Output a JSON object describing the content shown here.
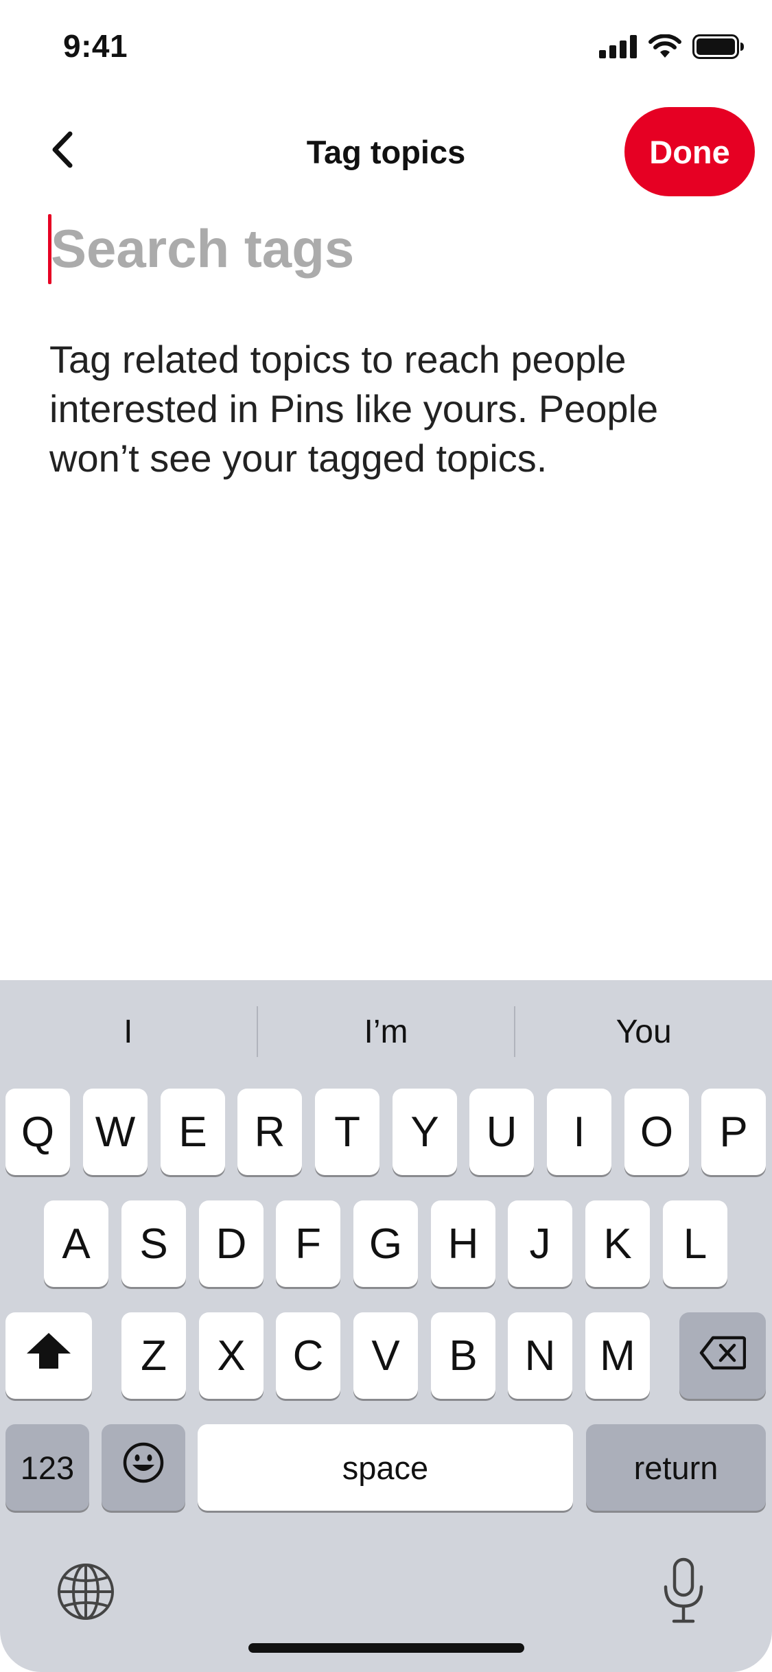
{
  "status_bar": {
    "time": "9:41",
    "icons": [
      "cellular-signal-icon",
      "wifi-icon",
      "battery-icon"
    ]
  },
  "header": {
    "back_icon": "chevron-left-icon",
    "title": "Tag topics",
    "done_label": "Done"
  },
  "search": {
    "placeholder": "Search tags",
    "value": ""
  },
  "description": "Tag related topics to reach people interested in Pins like yours. People won’t see your tagged topics.",
  "keyboard": {
    "suggestions": [
      "I",
      "I’m",
      "You"
    ],
    "row1": [
      "Q",
      "W",
      "E",
      "R",
      "T",
      "Y",
      "U",
      "I",
      "O",
      "P"
    ],
    "row2": [
      "A",
      "S",
      "D",
      "F",
      "G",
      "H",
      "J",
      "K",
      "L"
    ],
    "row3": [
      "Z",
      "X",
      "C",
      "V",
      "B",
      "N",
      "M"
    ],
    "numbers_label": "123",
    "space_label": "space",
    "return_label": "return",
    "icons": [
      "shift-icon",
      "backspace-icon",
      "emoji-icon",
      "globe-icon",
      "microphone-icon"
    ]
  },
  "colors": {
    "accent": "#e60023",
    "keyboard_bg": "#d1d4db",
    "placeholder": "#ababab"
  }
}
